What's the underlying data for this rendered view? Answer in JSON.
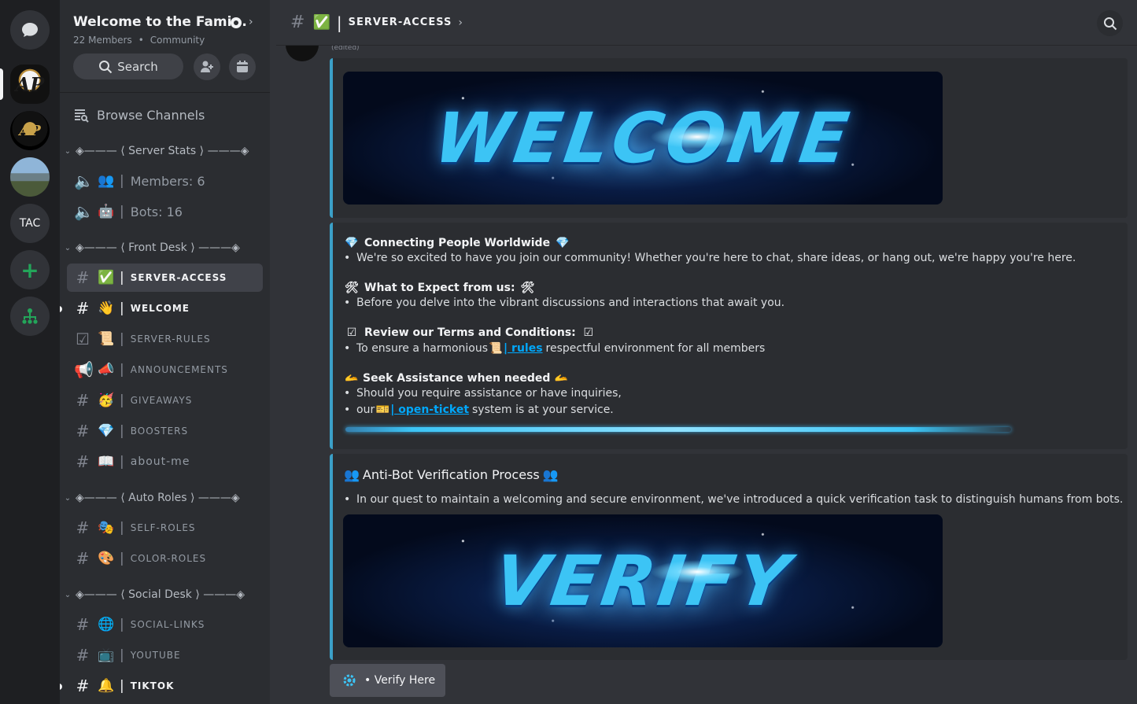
{
  "server": {
    "name": "Welcome to the Fami...",
    "members": "22 Members",
    "type": "Community",
    "search_label": "Search",
    "browse_label": "Browse Channels"
  },
  "rail": {
    "tac_label": "TAC"
  },
  "categories": {
    "stats": "◈——— ⟨ Server Stats ⟩ ———◈",
    "front": "◈——— ⟨ Front Desk ⟩ ———◈",
    "auto": "◈——— ⟨ Auto Roles ⟩ ———◈",
    "social": "◈——— ⟨ Social Desk ⟩ ———◈"
  },
  "channels": {
    "members": "Members: 6",
    "bots": "Bots: 16",
    "server_access": "server-access",
    "welcome": "welcome",
    "server_rules": "server-rules",
    "announcements": "announcements",
    "giveaways": "giveaways",
    "boosters": "boosters",
    "about_me": "about-me",
    "self_roles": "self-roles",
    "color_roles": "color-roles",
    "social_links": "social-links",
    "youtube": "youtube",
    "tiktok": "tiktok"
  },
  "header": {
    "channel_title": "SERVER-ACCESS"
  },
  "message": {
    "edited": "(edited)",
    "banner1": "WELCOME",
    "banner2": "VERIFY",
    "s1_title": "Connecting People Worldwide",
    "s1_text": "We're so excited to have you join our community! Whether you're here to chat, share ideas, or hang out, we're happy you're here.",
    "s2_title": "What to Expect from us:",
    "s2_text": "Before you delve into the vibrant discussions and interactions that await you.",
    "s3_title": "Review our Terms and Conditions:",
    "s3_text_pre": "To ensure a harmonious",
    "s3_link": "| rules",
    "s3_text_post": "respectful environment for all members",
    "s4_title": "Seek Assistance when needed",
    "s4_text1": "Should you require assistance or have inquiries,",
    "s4_text2_pre": "our",
    "s4_link": "| open-ticket",
    "s4_text2_post": "system is at your service.",
    "e3_title": "Anti-Bot Verification Process",
    "e3_text": "In our quest to maintain a welcoming and secure environment, we've introduced a quick verification task to distinguish humans from bots."
  },
  "verify_button": {
    "label": "• Verify Here"
  },
  "colors": {
    "accent": "#3ba0c8",
    "link": "#00a8fc",
    "background": "#313338",
    "sidebar": "#2b2d31",
    "rail": "#1e1f22"
  }
}
